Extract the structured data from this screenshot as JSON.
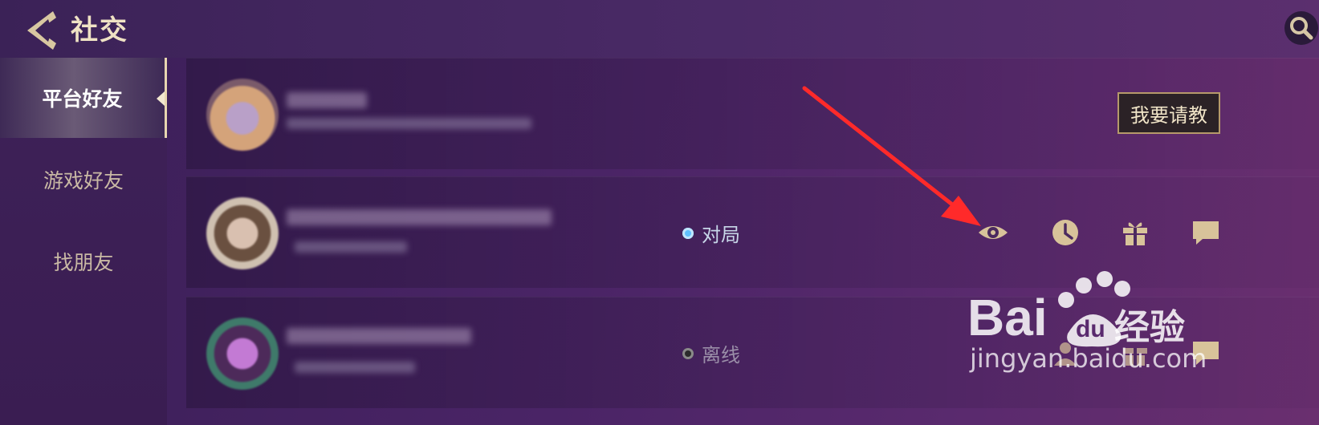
{
  "header": {
    "title": "社交"
  },
  "sidebar": {
    "items": [
      {
        "label": "平台好友",
        "active": true
      },
      {
        "label": "游戏好友",
        "active": false
      },
      {
        "label": "找朋友",
        "active": false
      }
    ]
  },
  "friends": [
    {
      "action_label": "我要请教"
    },
    {
      "status": "对局",
      "status_color": "#5fc1ff"
    },
    {
      "status": "离线",
      "status_color": "#8a8a8a"
    }
  ],
  "watermark": {
    "brand": "Bai du",
    "cn": "经验",
    "url": "jingyan.baidu.com"
  },
  "annotation_arrow_color": "#ff2a2a"
}
